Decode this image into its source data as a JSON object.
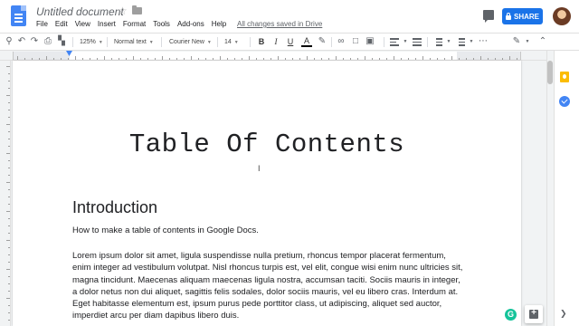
{
  "title_bar": {
    "doc_title": "Untitled document",
    "save_status": "All changes saved in Drive",
    "share_label": "SHARE"
  },
  "menu": {
    "items": [
      "File",
      "Edit",
      "View",
      "Insert",
      "Format",
      "Tools",
      "Add-ons",
      "Help"
    ]
  },
  "toolbar": {
    "zoom": "125%",
    "style": "Normal text",
    "font": "Courier New",
    "font_size": "14",
    "bold": "B",
    "italic": "I",
    "underline": "U",
    "text_color": "A"
  },
  "document": {
    "heading": "Table Of Contents",
    "section_heading": "Introduction",
    "section_subtitle": "How to make a table of contents in Google Docs.",
    "paragraph": "Lorem ipsum dolor sit amet, ligula suspendisse nulla pretium, rhoncus tempor placerat fermentum, enim integer ad vestibulum volutpat. Nisl rhoncus turpis est, vel elit, congue wisi enim nunc ultricies sit, magna tincidunt. Maecenas aliquam maecenas ligula nostra, accumsan taciti. Sociis mauris in integer, a dolor netus non dui aliquet, sagittis felis sodales, dolor sociis mauris, vel eu libero cras. Interdum at. Eget habitasse elementum est, ipsum purus pede porttitor class, ut adipiscing, aliquet sed auctor, imperdiet arcu per diam dapibus libero duis."
  },
  "floating": {
    "grammarly": "G"
  },
  "colors": {
    "accent": "#1a73e8",
    "docs_blue": "#4285f4",
    "keep_yellow": "#fbbc04",
    "grammarly_green": "#15c39a"
  }
}
